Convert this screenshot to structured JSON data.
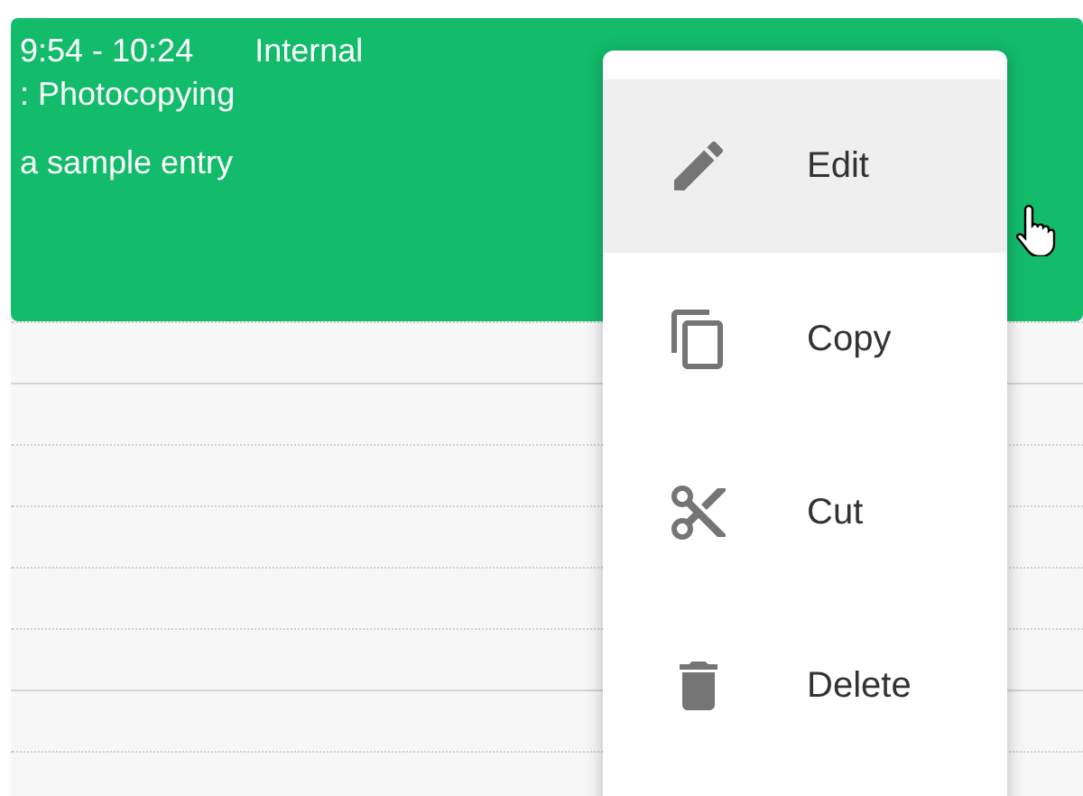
{
  "event": {
    "time": "9:54 - 10:24",
    "category": "Internal",
    "subcategory": ": Photocopying",
    "description": "a sample entry"
  },
  "context_menu": {
    "items": [
      {
        "label": "Edit",
        "kind": "edit",
        "selected": true
      },
      {
        "label": "Copy",
        "kind": "copy",
        "selected": false
      },
      {
        "label": "Cut",
        "kind": "cut",
        "selected": false
      },
      {
        "label": "Delete",
        "kind": "delete",
        "selected": false
      }
    ]
  }
}
